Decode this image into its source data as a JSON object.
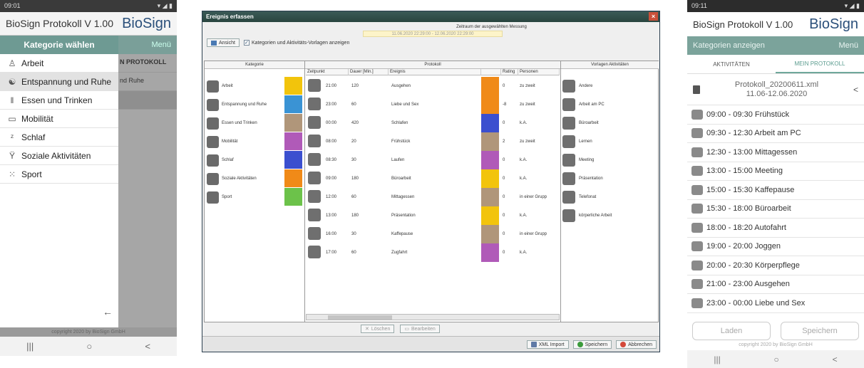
{
  "phone1": {
    "status_time": "09:01",
    "status_right": "▾ ◢ ▮",
    "app_title": "BioSign Protokoll V 1.00",
    "brand": "BioSign",
    "drawer_title": "Kategorie wählen",
    "menu_label": "Menü",
    "bg_rows": [
      "N PROTOKOLL",
      "nd Ruhe"
    ],
    "drawer_items": [
      {
        "label": "Arbeit",
        "icon": "worker-icon"
      },
      {
        "label": "Entspannung und Ruhe",
        "icon": "yin-yang-icon"
      },
      {
        "label": "Essen und Trinken",
        "icon": "cutlery-icon"
      },
      {
        "label": "Mobilität",
        "icon": "bus-icon"
      },
      {
        "label": "Schlaf",
        "icon": "sleep-icon"
      },
      {
        "label": "Soziale Aktivitäten",
        "icon": "cocktail-icon"
      },
      {
        "label": "Sport",
        "icon": "ball-icon"
      }
    ],
    "back_glyph": "←",
    "copyright": "copyright 2020 by BioSign GmbH",
    "nav": [
      "|||",
      "○",
      "<"
    ]
  },
  "window": {
    "title": "Ereignis erfassen",
    "zeitraum_label": "Zeitraum der ausgewählten Messung",
    "zeitraum_value": "11.06.2020 22:29:00 - 12.06.2020 22:29:00",
    "ansicht_label": "Ansicht",
    "checkbox_label": "Kategorien und Aktivitäts-Vorlagen anzeigen",
    "col_kategorie": "Kategorie",
    "col_protokoll": "Protokoll",
    "col_vorlagen": "Vorlagen Aktivitäten",
    "sub_headers": {
      "zeitpunkt": "Zeitpunkt",
      "dauer": "Dauer [Min.]",
      "ereignis": "Ereignis",
      "rating": "Rating",
      "personen": "Personen"
    },
    "kategorien": [
      {
        "label": "Arbeit",
        "color": "#f2c40c"
      },
      {
        "label": "Entspannung und Ruhe",
        "color": "#3a93d4"
      },
      {
        "label": "Essen und Trinken",
        "color": "#b0967a"
      },
      {
        "label": "Mobilität",
        "color": "#b05ab8"
      },
      {
        "label": "Schlaf",
        "color": "#3b4fcf"
      },
      {
        "label": "Soziale Aktivitäten",
        "color": "#f08a18"
      },
      {
        "label": "Sport",
        "color": "#6cc24a"
      }
    ],
    "protokoll": [
      {
        "zeit": "21:00",
        "dauer": "120",
        "ereignis": "Ausgehen",
        "color": "#f08a18",
        "rating": "0",
        "personen": "zu zweit"
      },
      {
        "zeit": "23:00",
        "dauer": "60",
        "ereignis": "Liebe und Sex",
        "color": "#f08a18",
        "rating": "-8",
        "personen": "zu zweit"
      },
      {
        "zeit": "00:00",
        "dauer": "420",
        "ereignis": "Schlafen",
        "color": "#3b4fcf",
        "rating": "0",
        "personen": "k.A."
      },
      {
        "zeit": "08:00",
        "dauer": "20",
        "ereignis": "Frühstück",
        "color": "#b0967a",
        "rating": "2",
        "personen": "zu zweit"
      },
      {
        "zeit": "08:30",
        "dauer": "30",
        "ereignis": "Laufen",
        "color": "#b05ab8",
        "rating": "0",
        "personen": "k.A."
      },
      {
        "zeit": "09:00",
        "dauer": "180",
        "ereignis": "Büroarbeit",
        "color": "#f2c40c",
        "rating": "0",
        "personen": "k.A."
      },
      {
        "zeit": "12:00",
        "dauer": "60",
        "ereignis": "Mittagessen",
        "color": "#b0967a",
        "rating": "0",
        "personen": "in einer Grupp"
      },
      {
        "zeit": "13:00",
        "dauer": "180",
        "ereignis": "Präsentation",
        "color": "#f2c40c",
        "rating": "0",
        "personen": "k.A."
      },
      {
        "zeit": "16:00",
        "dauer": "30",
        "ereignis": "Kaffepause",
        "color": "#b0967a",
        "rating": "0",
        "personen": "in einer Grupp"
      },
      {
        "zeit": "17:00",
        "dauer": "60",
        "ereignis": "Zugfahrt",
        "color": "#b05ab8",
        "rating": "0",
        "personen": "k.A."
      }
    ],
    "vorlagen": [
      "Andere",
      "Arbeit am PC",
      "Büroarbeit",
      "Lernen",
      "Meeting",
      "Präsentation",
      "Telefonat",
      "körperliche Arbeit"
    ],
    "loeschen": "Löschen",
    "bearbeiten": "Bearbeiten",
    "xml_import": "XML Import",
    "speichern": "Speichern",
    "abbrechen": "Abbrechen",
    "close_glyph": "×"
  },
  "phone2": {
    "status_time": "09:11",
    "status_right": "▾ ◢ ▮",
    "app_title": "BioSign Protokoll V 1.00",
    "brand": "BioSign",
    "teal_left": "Kategorien anzeigen",
    "teal_right": "Menü",
    "tab_aktivitaeten": "AKTIVITÄTEN",
    "tab_protokoll": "MEIN PROTOKOLL",
    "file_name_line1": "Protokoll_20200611.xml",
    "file_name_line2": "11.06-12.06.2020",
    "entries": [
      "09:00 - 09:30 Frühstück",
      "09:30 - 12:30 Arbeit am PC",
      "12:30 - 13:00 Mittagessen",
      "13:00 - 15:00 Meeting",
      "15:00 - 15:30 Kaffepause",
      "15:30 - 18:00 Büroarbeit",
      "18:00 - 18:20 Autofahrt",
      "19:00 - 20:00 Joggen",
      "20:00 - 20:30 Körperpflege",
      "21:00 - 23:00 Ausgehen",
      "23:00 - 00:00 Liebe und Sex"
    ],
    "laden": "Laden",
    "speichern": "Speichern",
    "copyright": "copyright 2020 by BioSign GmbH",
    "nav": [
      "|||",
      "○",
      "<"
    ]
  }
}
